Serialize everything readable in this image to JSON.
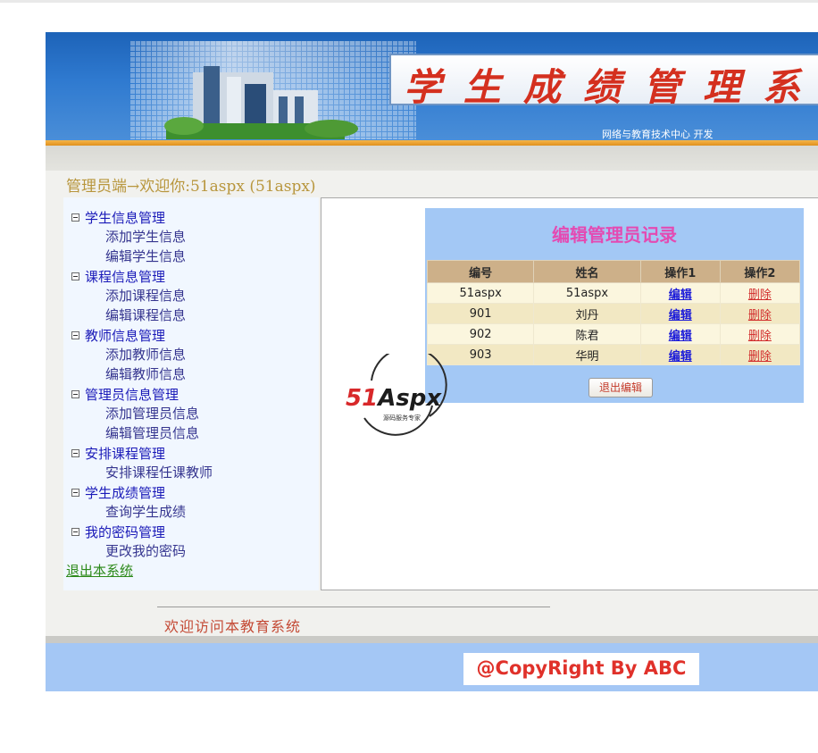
{
  "header": {
    "system_title": "学生成绩管理系统",
    "developer": "网络与教育技术中心  开发"
  },
  "welcome": {
    "text": "管理员端→欢迎你:51aspx (51aspx)"
  },
  "sidebar": {
    "groups": [
      {
        "label": "学生信息管理",
        "items": [
          "添加学生信息",
          "编辑学生信息"
        ]
      },
      {
        "label": "课程信息管理",
        "items": [
          "添加课程信息",
          "编辑课程信息"
        ]
      },
      {
        "label": "教师信息管理",
        "items": [
          "添加教师信息",
          "编辑教师信息"
        ]
      },
      {
        "label": "管理员信息管理",
        "items": [
          "添加管理员信息",
          "编辑管理员信息"
        ]
      },
      {
        "label": "安排课程管理",
        "items": [
          "安排课程任课教师"
        ]
      },
      {
        "label": "学生成绩管理",
        "items": [
          "查询学生成绩"
        ]
      },
      {
        "label": "我的密码管理",
        "items": [
          "更改我的密码"
        ]
      }
    ],
    "logout": "退出本系统"
  },
  "editor": {
    "title": "编辑管理员记录",
    "columns": [
      "编号",
      "姓名",
      "操作1",
      "操作2"
    ],
    "rows": [
      {
        "id": "51aspx",
        "name": "51aspx",
        "edit": "编辑",
        "delete": "删除"
      },
      {
        "id": "901",
        "name": "刘丹",
        "edit": "编辑",
        "delete": "删除"
      },
      {
        "id": "902",
        "name": "陈君",
        "edit": "编辑",
        "delete": "删除"
      },
      {
        "id": "903",
        "name": "华明",
        "edit": "编辑",
        "delete": "删除"
      }
    ],
    "exit_button": "退出编辑"
  },
  "watermark": {
    "brand": "51Aspx",
    "tagline": "源码服务专家"
  },
  "footer": {
    "welcome": "欢迎访问本教育系统",
    "copyright": "@CopyRight By ABC"
  },
  "colors": {
    "banner": "#2f7ad0",
    "sidebar_link": "#1a1ab8",
    "panel": "#a3c8f5",
    "panel_title": "#e44ab2",
    "accent_red": "#e0312a"
  }
}
